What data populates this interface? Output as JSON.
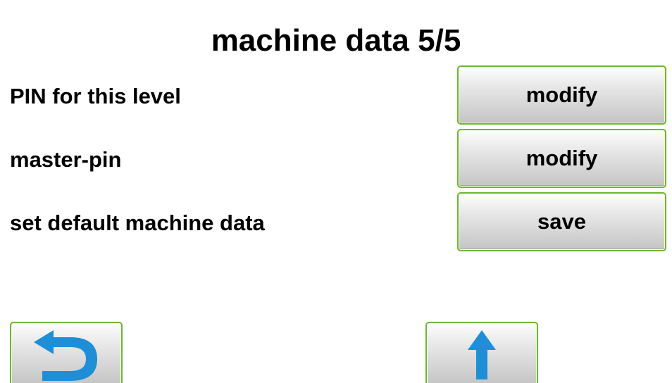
{
  "header": {
    "title": "machine data 5/5"
  },
  "settings": {
    "rows": [
      {
        "label": "PIN for this level",
        "button_label": "modify"
      },
      {
        "label": "master-pin",
        "button_label": "modify"
      },
      {
        "label": "set default machine data",
        "button_label": "save"
      }
    ]
  },
  "footer": {
    "back_icon": "back-arrow-icon",
    "up_icon": "up-arrow-icon"
  },
  "colors": {
    "button_border": "#6bb82e",
    "icon": "#1e8fd6",
    "text": "#000000",
    "background": "#ffffff"
  }
}
